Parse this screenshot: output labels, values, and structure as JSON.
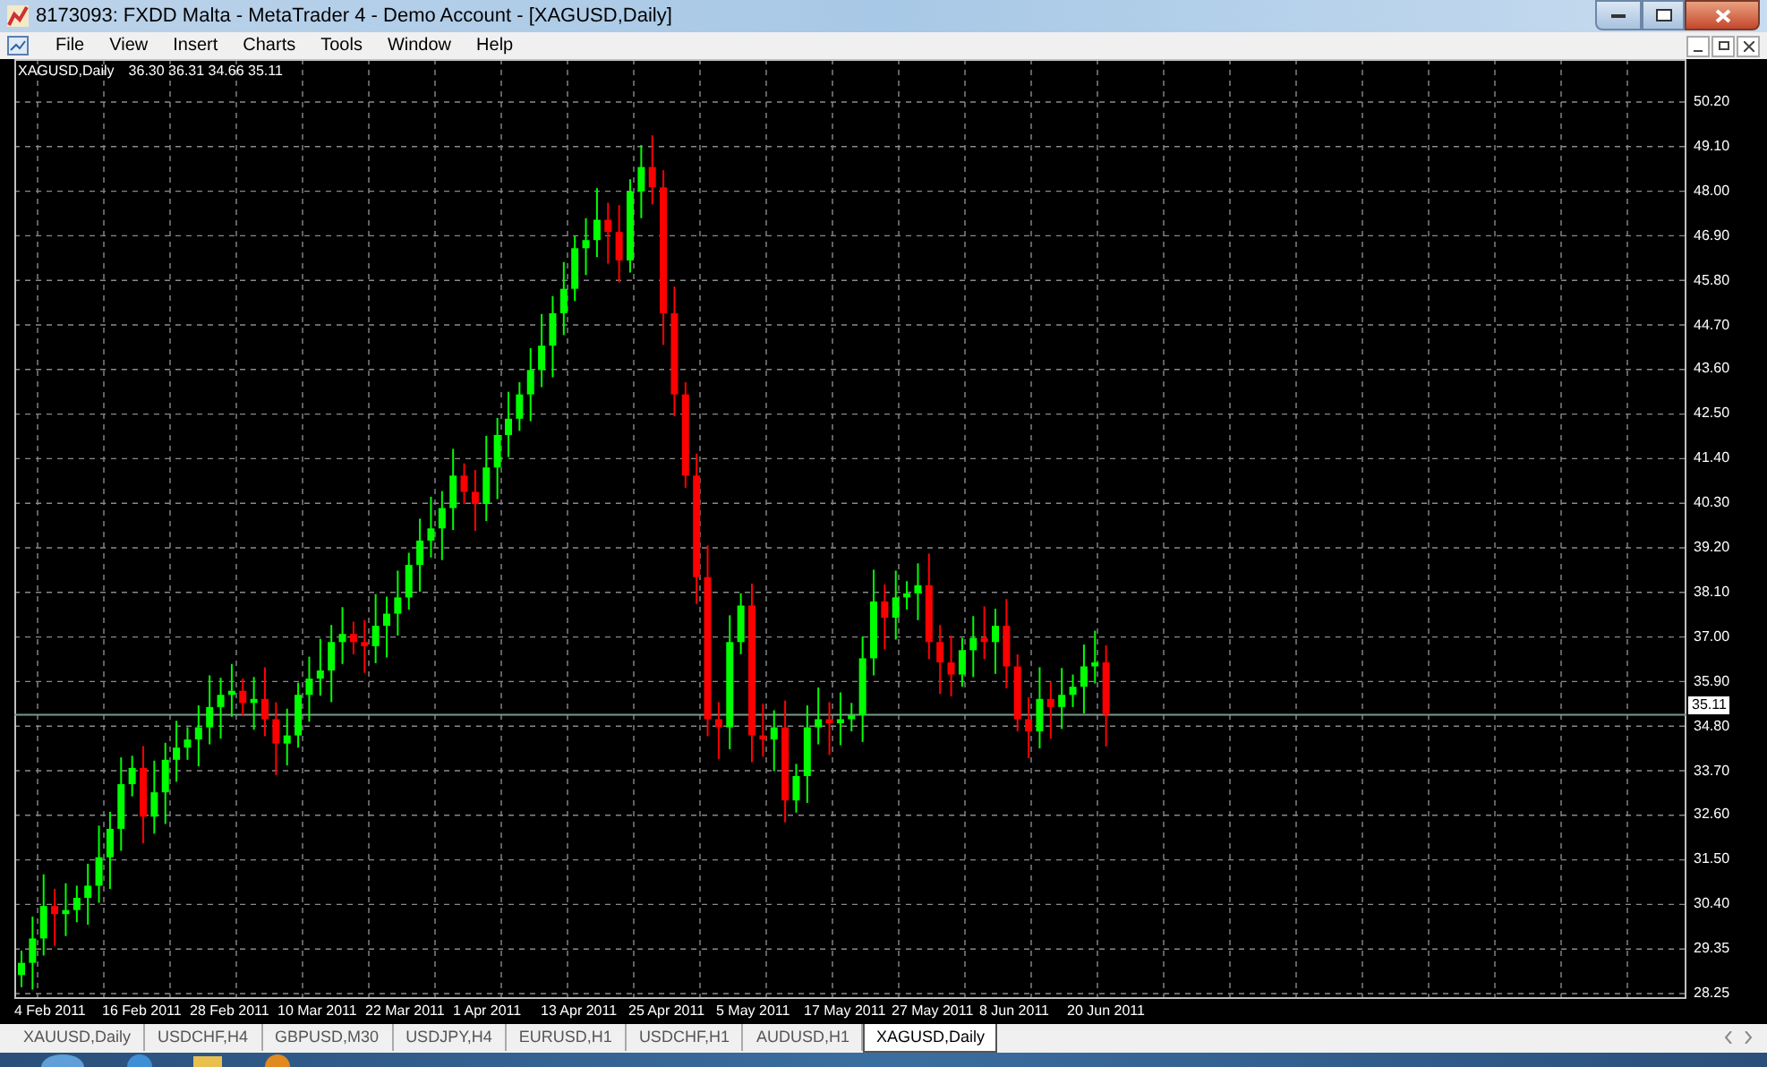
{
  "window": {
    "title": "8173093: FXDD Malta - MetaTrader 4 - Demo Account - [XAGUSD,Daily]"
  },
  "menu": [
    "File",
    "View",
    "Insert",
    "Charts",
    "Tools",
    "Window",
    "Help"
  ],
  "chart": {
    "symbol": "XAGUSD,Daily",
    "ohlc": "36.30 36.31 34.66 35.11",
    "current_price": "35.11",
    "price_labels": [
      "50.20",
      "49.10",
      "48.00",
      "46.90",
      "45.80",
      "44.70",
      "43.60",
      "42.50",
      "41.40",
      "40.30",
      "39.20",
      "38.10",
      "37.00",
      "35.90",
      "34.80",
      "33.70",
      "32.60",
      "31.50",
      "30.40",
      "29.35",
      "28.25"
    ],
    "date_labels": [
      "4 Feb 2011",
      "16 Feb 2011",
      "28 Feb 2011",
      "10 Mar 2011",
      "22 Mar 2011",
      "1 Apr 2011",
      "13 Apr 2011",
      "25 Apr 2011",
      "5 May 2011",
      "17 May 2011",
      "27 May 2011",
      "8 Jun 2011",
      "20 Jun 2011"
    ]
  },
  "tabs": [
    {
      "label": "XAUUSD,Daily",
      "selected": false
    },
    {
      "label": "USDCHF,H4",
      "selected": false
    },
    {
      "label": "GBPUSD,M30",
      "selected": false
    },
    {
      "label": "USDJPY,H4",
      "selected": false
    },
    {
      "label": "EURUSD,H1",
      "selected": false
    },
    {
      "label": "USDCHF,H1",
      "selected": false
    },
    {
      "label": "AUDUSD,H1",
      "selected": false
    },
    {
      "label": "XAGUSD,Daily",
      "selected": true
    }
  ]
}
